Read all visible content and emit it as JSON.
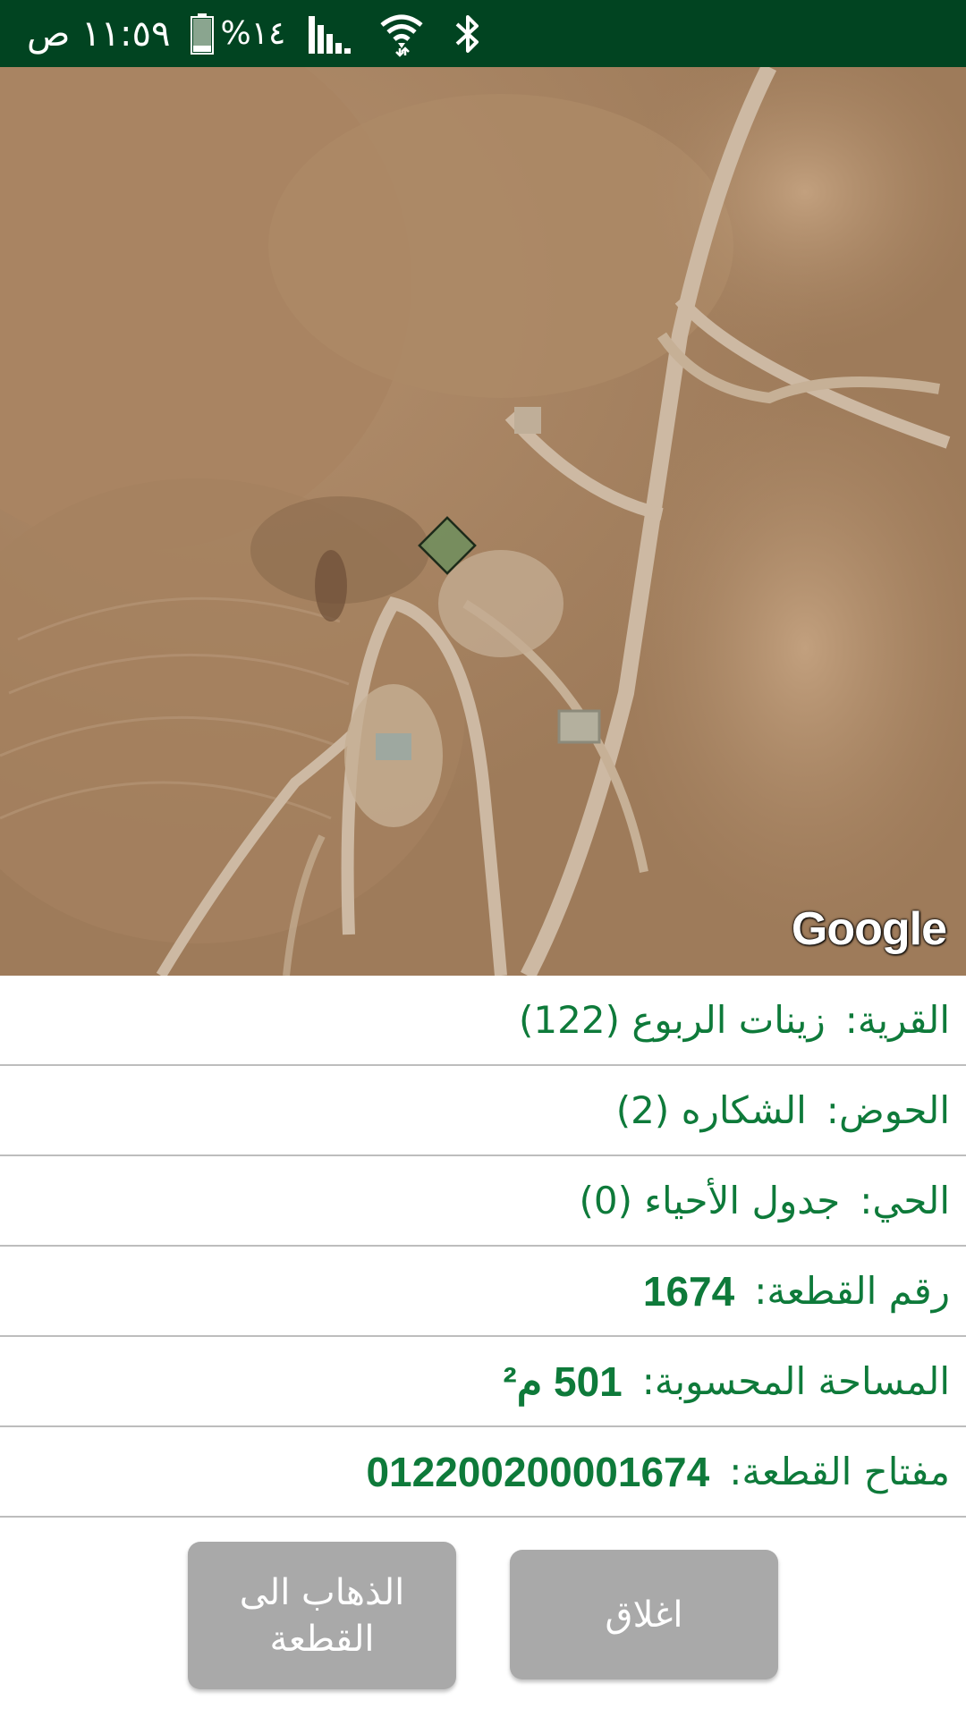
{
  "status_bar": {
    "time": "١١:٥٩ ص",
    "battery": "%١٤",
    "icons": [
      "battery-icon",
      "signal-icon",
      "wifi-icon",
      "bluetooth-icon"
    ]
  },
  "map": {
    "attribution": "Google"
  },
  "parcel_info": [
    {
      "label": "القرية:",
      "value": "زينات الربوع (122)"
    },
    {
      "label": "الحوض:",
      "value": "الشكاره (2)"
    },
    {
      "label": "الحي:",
      "value": "جدول الأحياء (0)"
    },
    {
      "label": "رقم القطعة:",
      "value": "1674"
    },
    {
      "label": "المساحة المحسوبة:",
      "value": "501 م²"
    },
    {
      "label": "مفتاح القطعة:",
      "value": "012200200001674"
    }
  ],
  "buttons": {
    "close": "اغلاق",
    "go_to_parcel": "الذهاب الى\nالقطعة"
  },
  "colors": {
    "status_bar": "#014421",
    "accent_text": "#0e7a3a",
    "button": "#a9a9a9",
    "parcel_fill": "#6e8f5e"
  }
}
